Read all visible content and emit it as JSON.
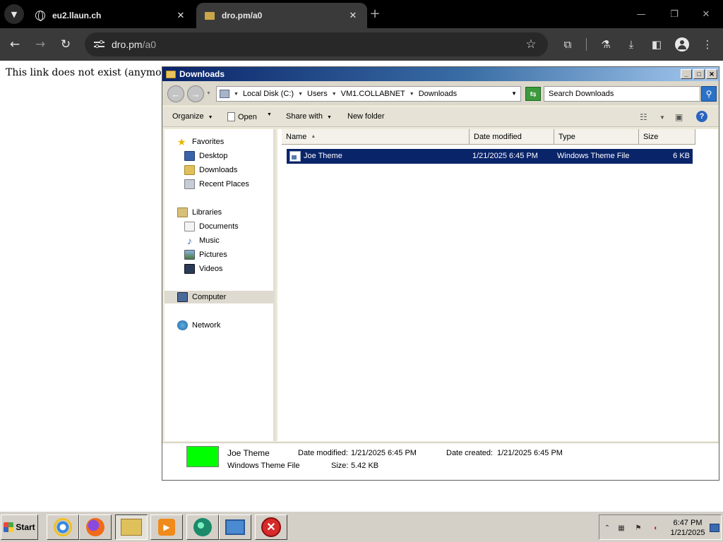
{
  "browser": {
    "tabs": [
      {
        "title": "eu2.llaun.ch",
        "active": false
      },
      {
        "title": "dro.pm/a0",
        "active": true
      }
    ],
    "address": {
      "host": "dro.pm",
      "path": "/a0"
    },
    "page_message": "This link does not exist (anymore)"
  },
  "explorer": {
    "window_title": "Downloads",
    "breadcrumb": [
      "Local Disk (C:)",
      "Users",
      "VM1.COLLABNET",
      "Downloads"
    ],
    "search_placeholder": "Search Downloads",
    "commands": {
      "organize": "Organize",
      "open": "Open",
      "share": "Share with",
      "new_folder": "New folder"
    },
    "nav": {
      "favorites": "Favorites",
      "desktop": "Desktop",
      "downloads": "Downloads",
      "recent": "Recent Places",
      "libraries": "Libraries",
      "documents": "Documents",
      "music": "Music",
      "pictures": "Pictures",
      "videos": "Videos",
      "computer": "Computer",
      "network": "Network"
    },
    "columns": {
      "name": "Name",
      "date": "Date modified",
      "type": "Type",
      "size": "Size"
    },
    "files": [
      {
        "name": "Joe Theme",
        "date": "1/21/2025 6:45 PM",
        "type": "Windows Theme File",
        "size": "6 KB"
      }
    ],
    "details": {
      "name": "Joe Theme",
      "type": "Windows Theme File",
      "modified_label": "Date modified:",
      "modified": "1/21/2025 6:45 PM",
      "created_label": "Date created:",
      "created": "1/21/2025 6:45 PM",
      "size_label": "Size:",
      "size": "5.42 KB",
      "thumbnail_color": "#00ff00"
    }
  },
  "taskbar": {
    "start_label": "Start",
    "clock_time": "6:47 PM",
    "clock_date": "1/21/2025"
  },
  "colors": {
    "selection": "#0a246a",
    "browser_frame": "#000000",
    "browser_toolbar": "#3a3a3a",
    "taskbar": "#d4d0c8"
  },
  "icons": [
    "tab-search-icon",
    "globe-icon",
    "close-icon",
    "back-arrow-icon",
    "forward-arrow-icon",
    "reload-icon",
    "site-settings-icon",
    "star-icon",
    "extensions-icon",
    "labs-icon",
    "download-icon",
    "sidepanel-icon",
    "profile-icon",
    "more-icon"
  ]
}
